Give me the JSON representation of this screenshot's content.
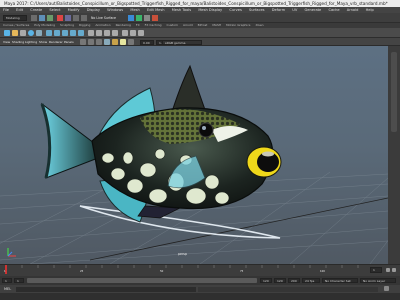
{
  "window": {
    "title": "Maya 2017: C:/Users/aut/Balistoides_Conspicillum_or_Bigspotted_Triggerfish_Rigged_for_maya/Balistoides_Conspicillum_or_Bigspotted_Triggerfish_Rigged_for_Maya_vrb_standard.mb*"
  },
  "menubar": {
    "items": [
      "File",
      "Edit",
      "Create",
      "Select",
      "Modify",
      "Display",
      "Windows",
      "Mesh",
      "Edit Mesh",
      "Mesh Tools",
      "Mesh Display",
      "Curves",
      "Surfaces",
      "Deform",
      "UV",
      "Generate",
      "Cache",
      "Arnold",
      "Help"
    ]
  },
  "status": {
    "mode_dropdown": "Modeling",
    "live_label": "No Live Surface"
  },
  "shelf": {
    "tabs": [
      "Curves / Surfaces",
      "Poly Modeling",
      "Sculpting",
      "Rigging",
      "Animation",
      "Rendering",
      "FX",
      "FX Caching",
      "Custom",
      "Arnold",
      "Bifrost",
      "MASH",
      "Motion Graphics",
      "XGen"
    ]
  },
  "panel": {
    "menu": [
      "View",
      "Shading",
      "Lighting",
      "Show",
      "Renderer",
      "Panels"
    ],
    "exposure": "0.00",
    "gamma": "1.00",
    "colorspace": "sRGB gamma"
  },
  "viewport": {
    "hud_camera": "persp"
  },
  "timeline": {
    "ticks": [
      "1",
      "5",
      "10",
      "15",
      "20",
      "25",
      "30",
      "35",
      "40",
      "45",
      "50",
      "55",
      "60",
      "65",
      "70",
      "75",
      "80",
      "85",
      "90",
      "95",
      "100",
      "105",
      "110",
      "115",
      "120"
    ],
    "current_frame": "1"
  },
  "range": {
    "start": "1",
    "inner_start": "1",
    "inner_end": "120",
    "end": "120",
    "end2": "200",
    "fps": "24 fps",
    "character_set": "No Character Set",
    "anim_layer": "No Anim Layer"
  },
  "cmdline": {
    "label": "MEL"
  }
}
